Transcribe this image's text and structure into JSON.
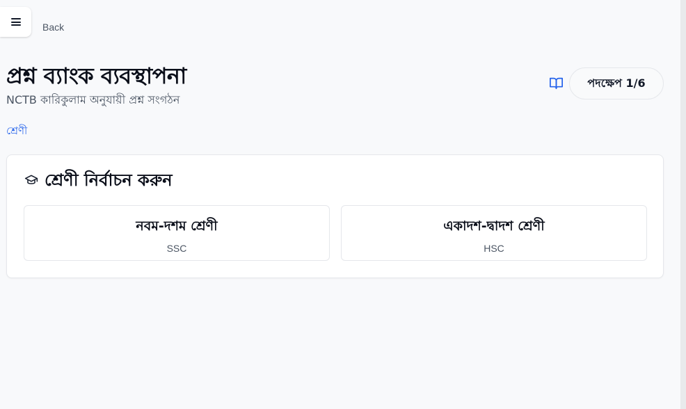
{
  "nav": {
    "menu_icon": "hamburger-menu-icon",
    "back_label": "Back"
  },
  "header": {
    "title": "প্রশ্ন ব্যাংক ব্যবস্থাপনা",
    "subtitle": "NCTB কারিকুলাম অনুযায়ী প্রশ্ন সংগঠন",
    "guide_icon": "open-book-icon",
    "step_label": "পদক্ষেপ 1/6",
    "accent_color": "#2563eb"
  },
  "breadcrumb": {
    "current": "শ্রেণী"
  },
  "class_selector": {
    "icon": "graduation-cap-icon",
    "title": "শ্রেণী নির্বাচন করুন",
    "options": [
      {
        "name": "নবম-দশম শ্রেণী",
        "code": "SSC"
      },
      {
        "name": "একাদশ-দ্বাদশ শ্রেণী",
        "code": "HSC"
      }
    ]
  }
}
